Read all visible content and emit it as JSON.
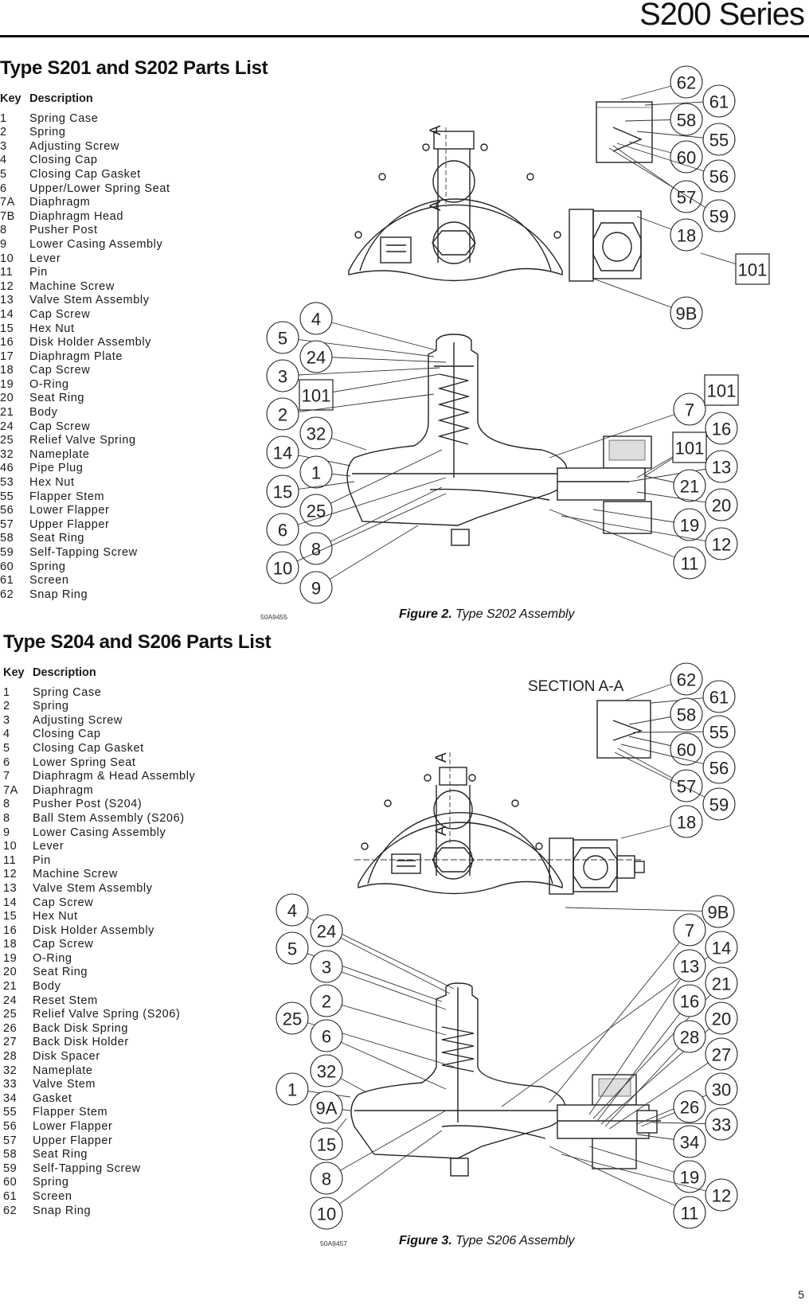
{
  "header": {
    "series_title": "S200 Series",
    "page_number": "5"
  },
  "list1": {
    "title": "Type S201 and S202 Parts List",
    "col_key": "Key",
    "col_desc": "Description",
    "items": [
      {
        "key": "1",
        "desc": "Spring Case"
      },
      {
        "key": "2",
        "desc": "Spring"
      },
      {
        "key": "3",
        "desc": "Adjusting Screw"
      },
      {
        "key": "4",
        "desc": "Closing Cap"
      },
      {
        "key": "5",
        "desc": "Closing Cap Gasket"
      },
      {
        "key": "6",
        "desc": "Upper/Lower Spring Seat"
      },
      {
        "key": "7A",
        "desc": "Diaphragm"
      },
      {
        "key": "7B",
        "desc": "Diaphragm Head"
      },
      {
        "key": "8",
        "desc": "Pusher Post"
      },
      {
        "key": "9",
        "desc": "Lower Casing Assembly"
      },
      {
        "key": "10",
        "desc": "Lever"
      },
      {
        "key": "11",
        "desc": "Pin"
      },
      {
        "key": "12",
        "desc": "Machine Screw"
      },
      {
        "key": "13",
        "desc": "Valve Stem Assembly"
      },
      {
        "key": "14",
        "desc": "Cap Screw"
      },
      {
        "key": "15",
        "desc": "Hex Nut"
      },
      {
        "key": "16",
        "desc": "Disk Holder Assembly"
      },
      {
        "key": "17",
        "desc": "Diaphragm Plate"
      },
      {
        "key": "18",
        "desc": "Cap Screw"
      },
      {
        "key": "19",
        "desc": "O-Ring"
      },
      {
        "key": "20",
        "desc": "Seat Ring"
      },
      {
        "key": "21",
        "desc": "Body"
      },
      {
        "key": "24",
        "desc": "Cap Screw"
      },
      {
        "key": "25",
        "desc": "Relief Valve Spring"
      },
      {
        "key": "32",
        "desc": "Nameplate"
      },
      {
        "key": "46",
        "desc": "Pipe Plug"
      },
      {
        "key": "53",
        "desc": "Hex Nut"
      },
      {
        "key": "55",
        "desc": "Flapper Stem"
      },
      {
        "key": "56",
        "desc": "Lower Flapper"
      },
      {
        "key": "57",
        "desc": "Upper Flapper"
      },
      {
        "key": "58",
        "desc": "Seat Ring"
      },
      {
        "key": "59",
        "desc": "Self-Tapping Screw"
      },
      {
        "key": "60",
        "desc": "Spring"
      },
      {
        "key": "61",
        "desc": "Screen"
      },
      {
        "key": "62",
        "desc": "Snap Ring"
      }
    ]
  },
  "list2": {
    "title": "Type S204 and S206 Parts List",
    "col_key": "Key",
    "col_desc": "Description",
    "items": [
      {
        "key": "1",
        "desc": "Spring Case"
      },
      {
        "key": "2",
        "desc": "Spring"
      },
      {
        "key": "3",
        "desc": "Adjusting Screw"
      },
      {
        "key": "4",
        "desc": "Closing Cap"
      },
      {
        "key": "5",
        "desc": "Closing Cap Gasket"
      },
      {
        "key": "6",
        "desc": "Lower Spring Seat"
      },
      {
        "key": "7",
        "desc": "Diaphragm & Head Assembly"
      },
      {
        "key": "7A",
        "desc": "Diaphragm"
      },
      {
        "key": "8",
        "desc": "Pusher Post (S204)"
      },
      {
        "key": "8",
        "desc": "Ball Stem Assembly (S206)"
      },
      {
        "key": "9",
        "desc": "Lower Casing Assembly"
      },
      {
        "key": "10",
        "desc": "Lever"
      },
      {
        "key": "11",
        "desc": "Pin"
      },
      {
        "key": "12",
        "desc": "Machine Screw"
      },
      {
        "key": "13",
        "desc": "Valve Stem Assembly"
      },
      {
        "key": "14",
        "desc": "Cap Screw"
      },
      {
        "key": "15",
        "desc": "Hex Nut"
      },
      {
        "key": "16",
        "desc": "Disk Holder Assembly"
      },
      {
        "key": "18",
        "desc": "Cap Screw"
      },
      {
        "key": "19",
        "desc": "O-Ring"
      },
      {
        "key": "20",
        "desc": "Seat Ring"
      },
      {
        "key": "21",
        "desc": "Body"
      },
      {
        "key": "24",
        "desc": "Reset Stem"
      },
      {
        "key": "25",
        "desc": "Relief Valve Spring (S206)"
      },
      {
        "key": "26",
        "desc": "Back Disk Spring"
      },
      {
        "key": "27",
        "desc": "Back Disk Holder"
      },
      {
        "key": "28",
        "desc": "Disk Spacer"
      },
      {
        "key": "32",
        "desc": "Nameplate"
      },
      {
        "key": "33",
        "desc": "Valve Stem"
      },
      {
        "key": "34",
        "desc": "Gasket"
      },
      {
        "key": "55",
        "desc": "Flapper Stem"
      },
      {
        "key": "56",
        "desc": "Lower Flapper"
      },
      {
        "key": "57",
        "desc": "Upper Flapper"
      },
      {
        "key": "58",
        "desc": "Seat Ring"
      },
      {
        "key": "59",
        "desc": "Self-Tapping Screw"
      },
      {
        "key": "60",
        "desc": "Spring"
      },
      {
        "key": "61",
        "desc": "Screen"
      },
      {
        "key": "62",
        "desc": "Snap Ring"
      }
    ]
  },
  "figure2": {
    "code": "50A9455",
    "caption_bold": "Figure 2.",
    "caption_text": " Type S202 Assembly",
    "section_marks": [
      "A",
      "A"
    ],
    "callouts": [
      "62",
      "61",
      "58",
      "55",
      "60",
      "56",
      "57",
      "59",
      "18",
      "101",
      "9B",
      "4",
      "5",
      "24",
      "3",
      "101",
      "2",
      "32",
      "14",
      "1",
      "15",
      "25",
      "6",
      "8",
      "10",
      "9",
      "7",
      "101",
      "16",
      "101",
      "13",
      "21",
      "20",
      "19",
      "12",
      "11"
    ]
  },
  "figure3": {
    "code": "50A9457",
    "caption_bold": "Figure 3.",
    "caption_text": " Type S206 Assembly",
    "section_label": "SECTION A-A",
    "section_marks": [
      "A",
      "A"
    ],
    "callouts": [
      "62",
      "61",
      "58",
      "55",
      "60",
      "56",
      "57",
      "59",
      "18",
      "9B",
      "4",
      "24",
      "5",
      "3",
      "2",
      "25",
      "6",
      "32",
      "1",
      "9A",
      "15",
      "8",
      "10",
      "7",
      "14",
      "13",
      "21",
      "16",
      "20",
      "28",
      "27",
      "30",
      "26",
      "33",
      "34",
      "19",
      "12",
      "11"
    ]
  }
}
